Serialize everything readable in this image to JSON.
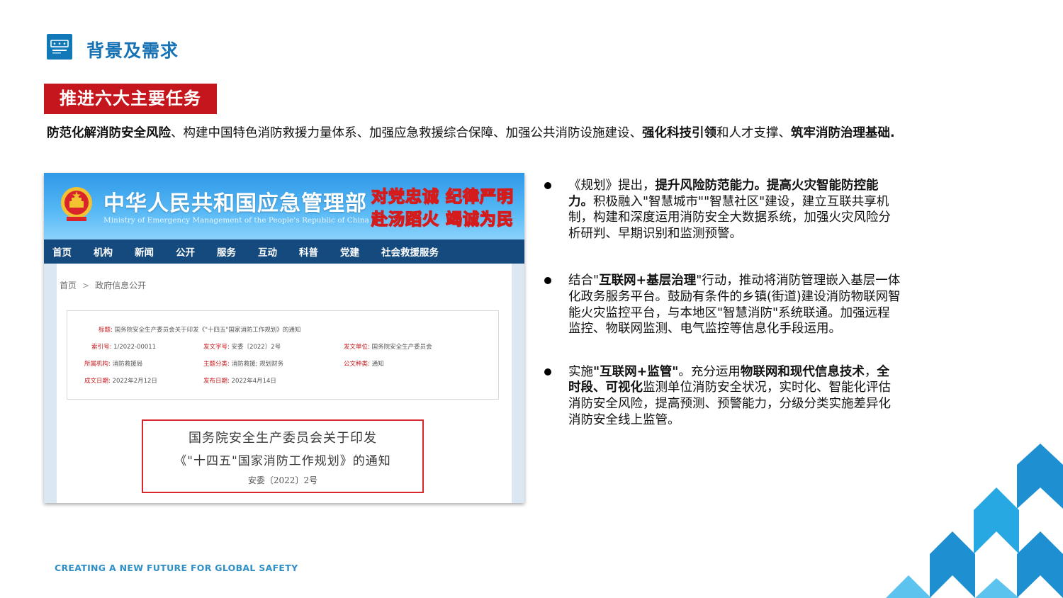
{
  "header": {
    "logo_icon": "company-logo-icon",
    "title": "背景及需求"
  },
  "banner": {
    "label": "推进六大主要任务"
  },
  "intro": {
    "p1_bold": "防范化解消防安全风险",
    "p1_a": "、构建中国特色消防救援力量体系、加强应急救援综合保障、加强公共消防设施建设、",
    "p1_bold2": "强化科技引领",
    "p1_b": "和人才支撑、",
    "p1_bold3": "筑牢消防治理基础",
    "p1_end": "."
  },
  "screenshot": {
    "ministry_cn": "中华人民共和国应急管理部",
    "ministry_en": "Ministry of Emergency Management of the People's Republic of China",
    "slogan_1": "对党忠诚 纪律严明",
    "slogan_2": "赴汤蹈火 竭诚为民",
    "nav": [
      "首页",
      "机构",
      "新闻",
      "公开",
      "服务",
      "互动",
      "科普",
      "党建",
      "社会救援服务"
    ],
    "breadcrumb": {
      "home": "首页",
      "sep": ">",
      "current": "政府信息公开"
    },
    "meta": {
      "title_k": "标题:",
      "title_v": "国务院安全生产委员会关于印发《\"十四五\"国家消防工作规划》的通知",
      "index_k": "索引号:",
      "index_v": "1/2022-00011",
      "docno_k": "发文字号:",
      "docno_v": "安委〔2022〕2号",
      "issuer_k": "发文单位:",
      "issuer_v": "国务院安全生产委员会",
      "org_k": "所属机构:",
      "org_v": "消防救援局",
      "topic_k": "主题分类:",
      "topic_v": "消防救援; 规划财务",
      "type_k": "公文种类:",
      "type_v": "通知",
      "created_k": "成文日期:",
      "created_v": "2022年2月12日",
      "published_k": "发布日期:",
      "published_v": "2022年4月14日"
    },
    "notice": {
      "line1": "国务院安全生产委员会关于印发",
      "line2": "《\"十四五\"国家消防工作规划》的通知",
      "line3": "安委〔2022〕2号"
    }
  },
  "bullets": {
    "b1": {
      "a": "《规划》提出，",
      "bold": "提升风险防范能力。提高火灾智能防控能力。",
      "b": "积极融入\"智慧城市\"\"智慧社区\"建设，建立互联共享机制，构建和深度运用消防安全大数据系统，加强火灾风险分析研判、早期识别和监测预警。"
    },
    "b2": {
      "a": "结合\"",
      "bold": "互联网+基层治理",
      "b": "\"行动，推动将消防管理嵌入基层一体化政务服务平台。鼓励有条件的乡镇(街道)建设消防物联网智能火灾监控平台，与本地区\"智慧消防\"系统联通。加强远程监控、物联网监测、电气监控等信息化手段运用。"
    },
    "b3": {
      "a": "实施",
      "bold": "\"互联网+监管\"",
      "b": "。充分运用",
      "bold2": "物联网和现代信息技术",
      "c": "，",
      "bold3": "全时段、可视化",
      "d": "监测单位消防安全状况，实时化、智能化评估消防安全风险，提高预测、预警能力，分级分类实施差异化消防安全线上监管。"
    }
  },
  "footer": {
    "tagline": "CREATING A NEW FUTURE FOR GLOBAL SAFETY"
  },
  "colors": {
    "title_blue": "#1672b4",
    "banner_red": "#c4161c",
    "nav_blue": "#144a7e",
    "deco_blue": "#1e9ad6"
  }
}
